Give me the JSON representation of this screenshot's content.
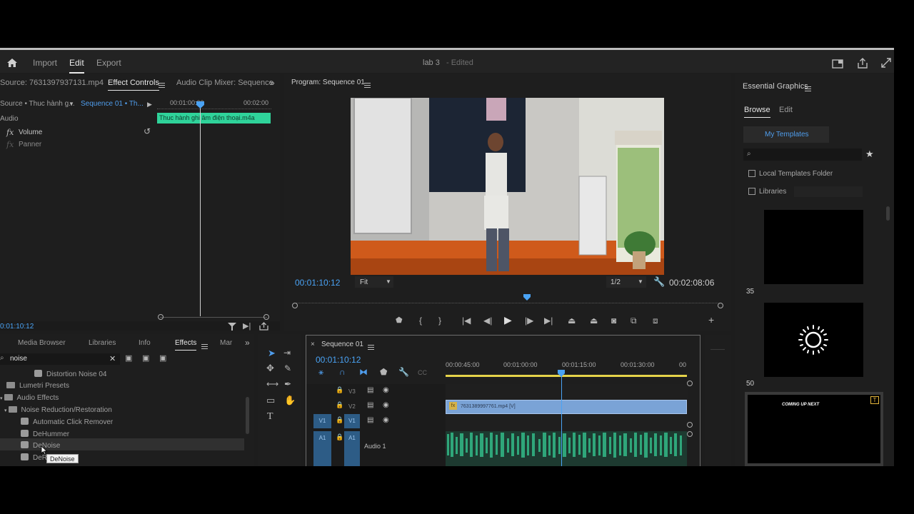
{
  "appbar": {
    "import": "Import",
    "edit": "Edit",
    "export": "Export",
    "project_name": "lab 3",
    "project_status": "- Edited"
  },
  "source_panel": {
    "tab_source": "Source: 7631397937131.mp4",
    "tab_effect_controls": "Effect Controls",
    "tab_audio_mixer": "Audio Clip Mixer: Sequence",
    "source_selector": "Source • Thuc hành g...",
    "sequence_selector": "Sequence 01 • Th...",
    "ruler_start": "00:01:00:00",
    "ruler_end": "00:02:00",
    "clip_name": "Thuc hành ghi âm điện thoại.m4a",
    "section_audio": "Audio",
    "prop_volume": "Volume",
    "prop_panner": "Panner",
    "timecode": "0:01:10:12"
  },
  "program_monitor": {
    "title": "Program: Sequence 01",
    "timecode_current": "00:01:10:12",
    "fit_label": "Fit",
    "resolution": "1/2",
    "timecode_duration": "00:02:08:06"
  },
  "essential_graphics": {
    "title": "Essential Graphics",
    "tab_browse": "Browse",
    "tab_edit": "Edit",
    "my_templates": "My Templates",
    "local_templates": "Local Templates Folder",
    "libraries": "Libraries",
    "label_35": "35",
    "label_50": "50",
    "thumb3_text": "COMING UP NEXT"
  },
  "effects_panel": {
    "tab_media_browser": "Media Browser",
    "tab_libraries": "Libraries",
    "tab_info": "Info",
    "tab_effects": "Effects",
    "tab_markers": "Mar",
    "search_value": "noise",
    "items": [
      {
        "label": "Distortion Noise 04",
        "type": "fx"
      },
      {
        "label": "Lumetri Presets",
        "type": "folder"
      },
      {
        "label": "Audio Effects",
        "type": "folder"
      },
      {
        "label": "Noise Reduction/Restoration",
        "type": "folder"
      },
      {
        "label": "Automatic Click Remover",
        "type": "fx"
      },
      {
        "label": "DeHummer",
        "type": "fx"
      },
      {
        "label": "DeNoise",
        "type": "fx"
      },
      {
        "label": "DeRe",
        "type": "fx"
      }
    ],
    "tooltip": "DeNoise"
  },
  "timeline": {
    "tab_label": "Sequence 01",
    "timecode": "00:01:10:12",
    "ruler": [
      "00:00:45:00",
      "00:01:00:00",
      "00:01:15:00",
      "00:01:30:00",
      "00"
    ],
    "tracks": {
      "v3": "V3",
      "v2": "V2",
      "v1": "V1",
      "a1": "A1",
      "a1_name": "Audio 1"
    },
    "video_clip": "7631389997761.mp4 [V]"
  }
}
